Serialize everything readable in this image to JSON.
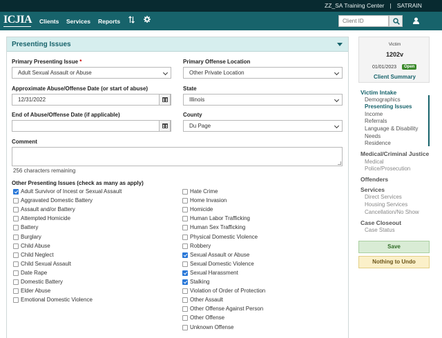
{
  "topbar": {
    "center_name": "ZZ_SA Training Center",
    "separator": "|",
    "user": "SATRAIN"
  },
  "nav": {
    "logo": "ICJIA",
    "clients": "Clients",
    "services": "Services",
    "reports": "Reports",
    "client_id_placeholder": "Client ID"
  },
  "panel": {
    "title": "Presenting Issues"
  },
  "form": {
    "primary_issue_label": "Primary Presenting Issue",
    "required_mark": "*",
    "primary_issue_value": "Adult Sexual Assault or Abuse",
    "primary_location_label": "Primary Offense Location",
    "primary_location_value": "Other Private Location",
    "approx_date_label": "Approximate Abuse/Offense Date (or start of abuse)",
    "approx_date_value": "12/31/2022",
    "state_label": "State",
    "state_value": "Illinois",
    "end_date_label": "End of Abuse/Offense Date (if applicable)",
    "end_date_value": "",
    "county_label": "County",
    "county_value": "Du Page",
    "comment_label": "Comment",
    "chars_remaining": "256 characters remaining",
    "other_label": "Other Presenting Issues (check as many as apply)"
  },
  "issues_left": [
    {
      "label": "Adult Survivor of Incest or Sexual Assault",
      "checked": true
    },
    {
      "label": "Aggravated Domestic Battery",
      "checked": false
    },
    {
      "label": "Assault and/or Battery",
      "checked": false
    },
    {
      "label": "Attempted Homicide",
      "checked": false
    },
    {
      "label": "Battery",
      "checked": false
    },
    {
      "label": "Burglary",
      "checked": false
    },
    {
      "label": "Child Abuse",
      "checked": false
    },
    {
      "label": "Child Neglect",
      "checked": false
    },
    {
      "label": "Child Sexual Assault",
      "checked": false
    },
    {
      "label": "Date Rape",
      "checked": false
    },
    {
      "label": "Domestic Battery",
      "checked": false
    },
    {
      "label": "Elder Abuse",
      "checked": false
    },
    {
      "label": "Emotional Domestic Violence",
      "checked": false
    }
  ],
  "issues_right": [
    {
      "label": "Hate Crime",
      "checked": false
    },
    {
      "label": "Home Invasion",
      "checked": false
    },
    {
      "label": "Homicide",
      "checked": false
    },
    {
      "label": "Human Labor Trafficking",
      "checked": false
    },
    {
      "label": "Human Sex Trafficking",
      "checked": false
    },
    {
      "label": "Physical Domestic Violence",
      "checked": false
    },
    {
      "label": "Robbery",
      "checked": false
    },
    {
      "label": "Sexual Assault or Abuse",
      "checked": true
    },
    {
      "label": "Sexual Domestic Violence",
      "checked": false
    },
    {
      "label": "Sexual Harassment",
      "checked": true
    },
    {
      "label": "Stalking",
      "checked": true
    },
    {
      "label": "Violation of Order of Protection",
      "checked": false
    },
    {
      "label": "Other Assault",
      "checked": false
    },
    {
      "label": "Other Offense Against Person",
      "checked": false
    },
    {
      "label": "Other Offense",
      "checked": false
    },
    {
      "label": "Unknown Offense",
      "checked": false
    }
  ],
  "sidebar": {
    "victim_label": "Victim",
    "victim_id": "1202v",
    "date": "01/01/2023",
    "status": "Open",
    "summary_link": "Client Summary",
    "victim_intake": "Victim Intake",
    "intake_items": [
      "Demographics",
      "Presenting Issues",
      "Income",
      "Referrals",
      "Language & Disability",
      "Needs",
      "Residence"
    ],
    "medical": "Medical/Criminal Justice",
    "medical_items": [
      "Medical",
      "Police/Prosecution"
    ],
    "offenders": "Offenders",
    "services": "Services",
    "services_items": [
      "Direct Services",
      "Housing Services",
      "Cancellation/No Show"
    ],
    "closeout": "Case Closeout",
    "closeout_items": [
      "Case Status"
    ],
    "save": "Save",
    "undo": "Nothing to Undo"
  },
  "colors": {
    "brand": "#17636b",
    "topbar": "#082a30",
    "checkbox": "#2a78d8",
    "open_badge": "#3c8a2c"
  }
}
